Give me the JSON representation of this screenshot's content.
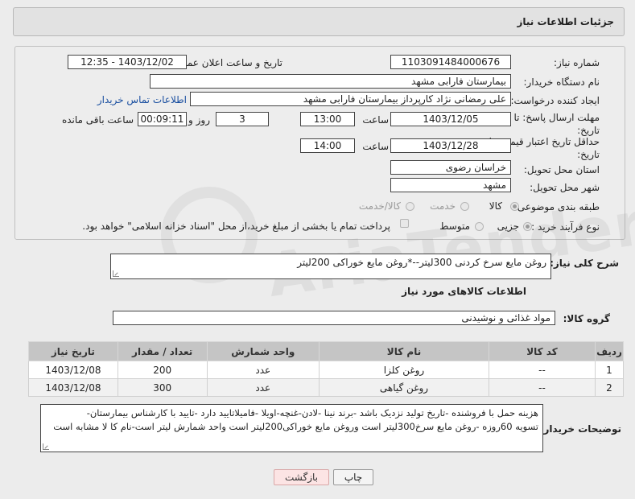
{
  "header": {
    "title": "جزئیات اطلاعات نیاز"
  },
  "form": {
    "need_number": {
      "label": "شماره نیاز:",
      "value": "1103091484000676"
    },
    "announce_datetime": {
      "label": "تاریخ و ساعت اعلان عمومی:",
      "value": "1403/12/02 - 12:35"
    },
    "buyer_org": {
      "label": "نام دستگاه خریدار:",
      "value": "بیمارستان فارابی مشهد"
    },
    "requester": {
      "label": "ایجاد کننده درخواست:",
      "value": "علی رمضانی نژاد کارپرداز بیمارستان فارابی مشهد",
      "contact_link": "اطلاعات تماس خریدار"
    },
    "reply_deadline": {
      "label": "مهلت ارسال پاسخ: تا تاریخ:",
      "date": "1403/12/05",
      "time_label": "ساعت",
      "time": "13:00",
      "days": "3",
      "days_label": "روز و",
      "remaining": "00:09:11",
      "remaining_label": "ساعت باقی مانده"
    },
    "price_validity": {
      "label": "حداقل تاریخ اعتبار قیمت: تا تاریخ:",
      "date": "1403/12/28",
      "time_label": "ساعت",
      "time": "14:00"
    },
    "province": {
      "label": "استان محل تحویل:",
      "value": "خراسان رضوی"
    },
    "city": {
      "label": "شهر محل تحویل:",
      "value": "مشهد"
    },
    "category": {
      "label": "طبقه بندی موضوعی:",
      "options": [
        "کالا",
        "خدمت",
        "کالا/خدمت"
      ],
      "selected": 0
    },
    "process": {
      "label": "نوع فرآیند خرید :",
      "options": [
        "جزیی",
        "متوسط"
      ],
      "selected": 0,
      "payment_note": "پرداخت تمام یا بخشی از مبلغ خرید،از محل \"اسناد خزانه اسلامی\" خواهد بود."
    }
  },
  "summary": {
    "label": "شرح کلی نیاز:",
    "value": "روغن مایع سرخ کردنی 300لیتر--*روغن مایع خوراکی 200لیتر"
  },
  "goods_info_title": "اطلاعات کالاهای مورد نیاز",
  "goods_group": {
    "label": "گروه کالا:",
    "value": "مواد غذائی و نوشیدنی"
  },
  "table": {
    "headers": [
      "ردیف",
      "کد کالا",
      "نام کالا",
      "واحد شمارش",
      "تعداد / مقدار",
      "تاریخ نیاز"
    ],
    "rows": [
      [
        "1",
        "--",
        "روغن کلزا",
        "عدد",
        "200",
        "1403/12/08"
      ],
      [
        "2",
        "--",
        "روغن گیاهی",
        "عدد",
        "300",
        "1403/12/08"
      ]
    ]
  },
  "buyer_notes": {
    "label": "توضیحات خریدار:",
    "lines": [
      "هزینه حمل با فروشنده -تاریخ تولید نزدیک باشد -برند نینا -لادن-غنچه-اویلا -فامیلاتایید دارد -تایید با کارشناس بیمارستان-",
      "تسویه 60روزه -روغن مایع سرخ300لیتر است وروغن مایع خوراکی200لیتر است واحد شمارش لیتر است-نام کا لا مشابه است"
    ]
  },
  "buttons": {
    "print": "چاپ",
    "back": "بازگشت"
  },
  "colors": {
    "link": "#1a4fa0",
    "table_header": "#c5c5c5",
    "back_button": "#fce4e4"
  }
}
